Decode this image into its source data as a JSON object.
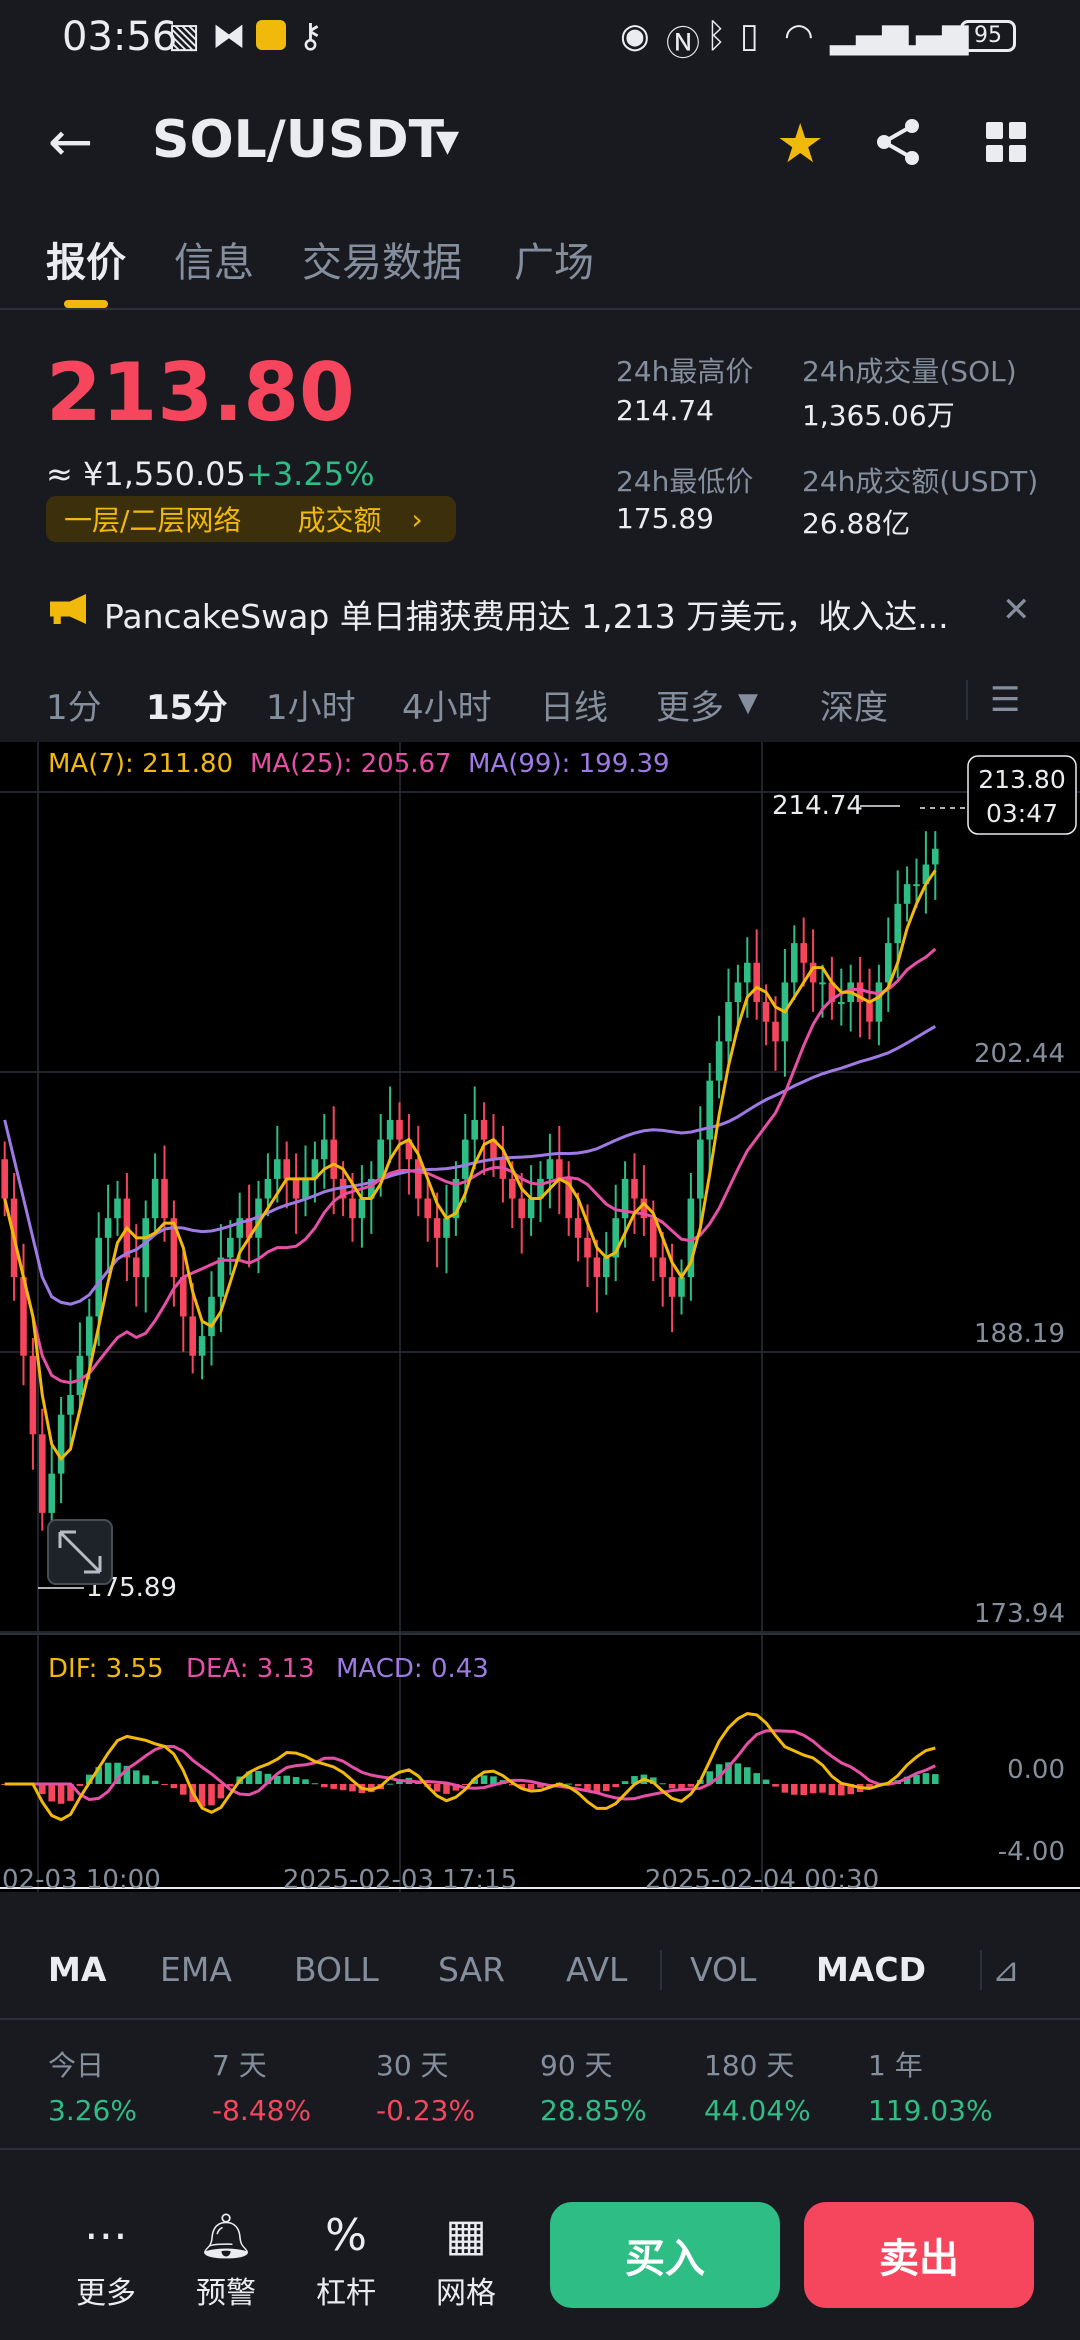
{
  "status_bar": {
    "time": "03:56",
    "battery": "95"
  },
  "header": {
    "pair": "SOL/USDT"
  },
  "tabs": [
    "报价",
    "信息",
    "交易数据",
    "广场"
  ],
  "ticker": {
    "last_price": "213.80",
    "cny": "≈ ¥1,550.05",
    "change": "+3.25%",
    "tag_layer": "一层/二层网络",
    "tag_volume": "成交额",
    "high_label": "24h最高价",
    "high": "214.74",
    "vol_sol_label": "24h成交量(SOL)",
    "vol_sol": "1,365.06万",
    "low_label": "24h最低价",
    "low": "175.89",
    "vol_usdt_label": "24h成交额(USDT)",
    "vol_usdt": "26.88亿"
  },
  "news": "PancakeSwap 单日捕获费用达 1,213 万美元，收入达...",
  "intervals": [
    "1分",
    "15分",
    "1小时",
    "4小时",
    "日线",
    "更多",
    "深度"
  ],
  "legend": {
    "ma7": "MA(7): 211.80",
    "ma25": "MA(25): 205.67",
    "ma99": "MA(99): 199.39"
  },
  "macd_legend": {
    "dif": "DIF: 3.55",
    "dea": "DEA: 3.13",
    "macd": "MACD: 0.43"
  },
  "colors": {
    "up": "#2ebd85",
    "down": "#f6465d",
    "ma7": "#f0b90b",
    "ma25": "#e64fa6",
    "ma99": "#9f7ae5",
    "accent": "#f0b90b"
  },
  "chart_data": {
    "type": "candlestick",
    "y_axis_ticks": [
      "216.69",
      "202.44",
      "188.19",
      "173.94"
    ],
    "ylim": [
      173.94,
      216.69
    ],
    "high_marker": "214.74",
    "low_marker": "175.89",
    "last_price_label": "213.80",
    "countdown": "03:47",
    "x_ticks": [
      "02-03 10:00",
      "2025-02-03 17:15",
      "2025-02-04 00:30"
    ],
    "closes": [
      196,
      192,
      188,
      184,
      180,
      182,
      185,
      186,
      188,
      190,
      194,
      195,
      196,
      193,
      192,
      195,
      197,
      195,
      192,
      190,
      188,
      189,
      191,
      193,
      194,
      195,
      194,
      196,
      197,
      198,
      197,
      196,
      197,
      198,
      199,
      197,
      196,
      195,
      196,
      197,
      199,
      200,
      199,
      198,
      196,
      195,
      194,
      195,
      197,
      199,
      200,
      199,
      198,
      197,
      196,
      195,
      196,
      197,
      198,
      197,
      195,
      194,
      193,
      192,
      193,
      195,
      197,
      196,
      195,
      193,
      192,
      191,
      192,
      196,
      199,
      202,
      204,
      206,
      207,
      208,
      206,
      205,
      204,
      207,
      209,
      208,
      207,
      207,
      206,
      206,
      207,
      206,
      205,
      207,
      209,
      211,
      212,
      212,
      213,
      213.8
    ],
    "macd_ticks": [
      "0.00",
      "-4.00"
    ]
  },
  "indicators": [
    "MA",
    "EMA",
    "BOLL",
    "SAR",
    "AVL",
    "VOL",
    "MACD"
  ],
  "performance": [
    {
      "label": "今日",
      "value": "3.26%"
    },
    {
      "label": "7 天",
      "value": "-8.48%"
    },
    {
      "label": "30 天",
      "value": "-0.23%"
    },
    {
      "label": "90 天",
      "value": "28.85%"
    },
    {
      "label": "180 天",
      "value": "44.04%"
    },
    {
      "label": "1 年",
      "value": "119.03%"
    }
  ],
  "bottom": {
    "more": "更多",
    "alert": "预警",
    "leverage": "杠杆",
    "grid": "网格",
    "buy": "买入",
    "sell": "卖出"
  }
}
